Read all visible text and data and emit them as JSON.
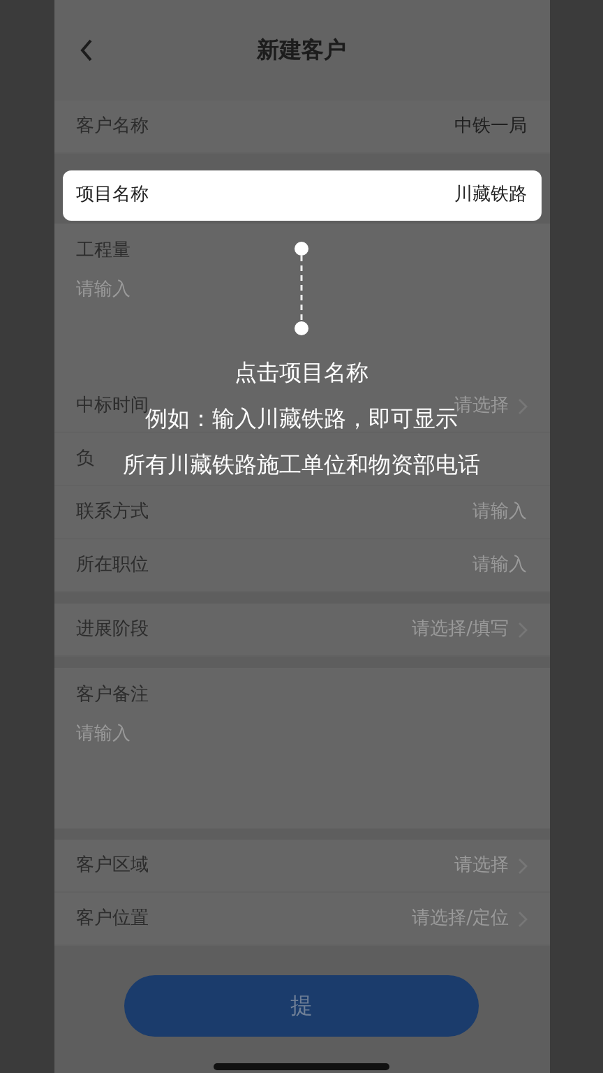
{
  "header": {
    "title": "新建客户"
  },
  "sections": [
    {
      "rows": [
        {
          "kind": "value",
          "label": "客户名称",
          "value": "中铁一局"
        }
      ]
    },
    {
      "highlighted": {
        "label": "项目名称",
        "value": "川藏铁路"
      }
    },
    {
      "rows": [
        {
          "kind": "textarea",
          "label": "工程量",
          "placeholder": "请输入"
        },
        {
          "kind": "select",
          "label": "中标时间",
          "placeholder": "请选择"
        },
        {
          "kind": "input",
          "label": "负"
        },
        {
          "kind": "input",
          "label": "联系方式",
          "placeholder": "请输入"
        },
        {
          "kind": "input",
          "label": "所在职位",
          "placeholder": "请输入"
        }
      ]
    },
    {
      "rows": [
        {
          "kind": "select",
          "label": "进展阶段",
          "placeholder": "请选择/填写"
        }
      ]
    },
    {
      "rows": [
        {
          "kind": "note",
          "label": "客户备注",
          "placeholder": "请输入"
        }
      ]
    },
    {
      "rows": [
        {
          "kind": "select",
          "label": "客户区域",
          "placeholder": "请选择"
        },
        {
          "kind": "select",
          "label": "客户位置",
          "placeholder": "请选择/定位"
        }
      ]
    }
  ],
  "guide": {
    "title": "点击项目名称",
    "lines": [
      "例如：输入川藏铁路，即可显示",
      "所有川藏铁路施工单位和物资部电话"
    ]
  },
  "submit": {
    "label": "提"
  }
}
